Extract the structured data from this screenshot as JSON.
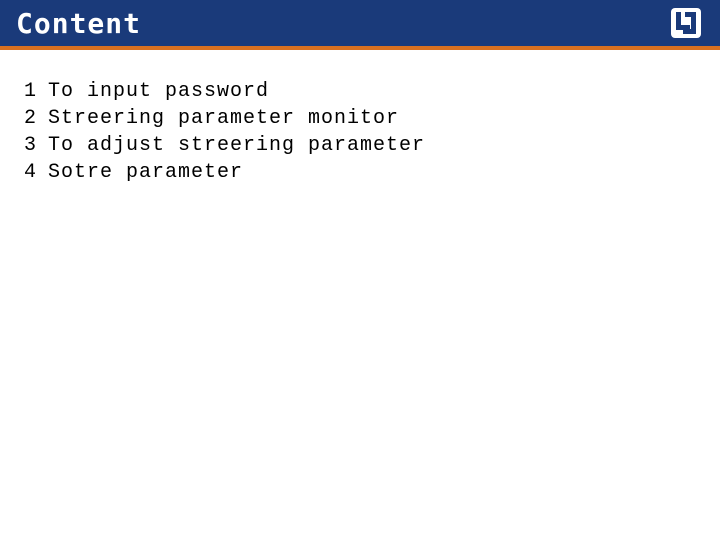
{
  "header": {
    "title": "Content",
    "logo_name": "lg-logo-icon"
  },
  "items": [
    {
      "num": "1",
      "text": "To input password"
    },
    {
      "num": "2",
      "text": "Streering parameter monitor"
    },
    {
      "num": "3",
      "text": "To adjust streering parameter"
    },
    {
      "num": "4",
      "text": "Sotre parameter"
    }
  ]
}
